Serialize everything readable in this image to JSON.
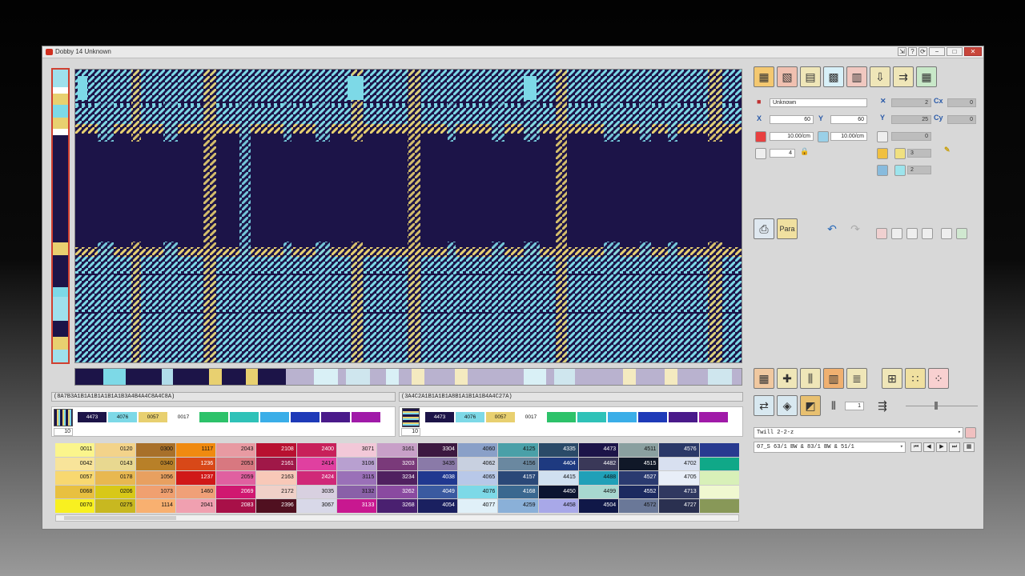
{
  "window": {
    "title": "Dobby 14 Unknown",
    "controls": [
      "⇲",
      "?",
      "⟳",
      "−",
      "□",
      "✕"
    ]
  },
  "colors": {
    "navy": "#1c1448",
    "cyan": "#7dd9e7",
    "yellow": "#e8d070",
    "lavender": "#b9b2cf"
  },
  "codes": {
    "warp": "(8A7B3A1B1A1B1A1B1A1B3A4B4A4C8A4C8A)",
    "weft": "(3A4C2A1B1A1B1A8B1A1B1A1B4A4C27A)"
  },
  "swatch_panels": [
    {
      "count": "10",
      "chips": [
        {
          "label": "4473",
          "color": "#1c1448"
        },
        {
          "label": "4076",
          "color": "#7dd9e7"
        },
        {
          "label": "0057",
          "color": "#e8d070"
        },
        {
          "label": "0017",
          "color": "#ffffff"
        },
        {
          "label": "",
          "color": "#2dc26a"
        },
        {
          "label": "",
          "color": "#2fc2b8"
        },
        {
          "label": "",
          "color": "#3aaee8"
        },
        {
          "label": "",
          "color": "#1e3ab8"
        },
        {
          "label": "",
          "color": "#4a1a8a"
        },
        {
          "label": "",
          "color": "#a01aa8"
        }
      ]
    },
    {
      "count": "10",
      "chips": [
        {
          "label": "4473",
          "color": "#1c1448"
        },
        {
          "label": "4076",
          "color": "#7dd9e7"
        },
        {
          "label": "0057",
          "color": "#e8d070"
        },
        {
          "label": "0017",
          "color": "#ffffff"
        },
        {
          "label": "",
          "color": "#2dc26a"
        },
        {
          "label": "",
          "color": "#2fc2b8"
        },
        {
          "label": "",
          "color": "#3aaee8"
        },
        {
          "label": "",
          "color": "#1e3ab8"
        },
        {
          "label": "",
          "color": "#4a1a8a"
        },
        {
          "label": "",
          "color": "#a01aa8"
        }
      ]
    }
  ],
  "palette": [
    {
      "code": "0011",
      "color": "#fbf58c"
    },
    {
      "code": "0120",
      "color": "#f3d38a"
    },
    {
      "code": "0300",
      "color": "#a8702a"
    },
    {
      "code": "1117",
      "color": "#f08a10"
    },
    {
      "code": "2043",
      "color": "#e89aa2"
    },
    {
      "code": "2108",
      "color": "#b81030"
    },
    {
      "code": "2400",
      "color": "#c8205a"
    },
    {
      "code": "3071",
      "color": "#f2c8d8"
    },
    {
      "code": "3161",
      "color": "#c8a0c8"
    },
    {
      "code": "3304",
      "color": "#3c1840"
    },
    {
      "code": "4060",
      "color": "#8aa0c8"
    },
    {
      "code": "4125",
      "color": "#4aa0a8"
    },
    {
      "code": "4335",
      "color": "#2a4a68"
    },
    {
      "code": "4473",
      "color": "#1c1448"
    },
    {
      "code": "4511",
      "color": "#8aa0a0"
    },
    {
      "code": "4576",
      "color": "#2a3868"
    },
    {
      "code": "",
      "color": "#283a90"
    },
    {
      "code": "0042",
      "color": "#f8e49a"
    },
    {
      "code": "0143",
      "color": "#e8d890"
    },
    {
      "code": "0340",
      "color": "#b88028"
    },
    {
      "code": "1236",
      "color": "#d84818"
    },
    {
      "code": "2053",
      "color": "#d87880"
    },
    {
      "code": "2161",
      "color": "#a01848"
    },
    {
      "code": "2414",
      "color": "#e040a0"
    },
    {
      "code": "3106",
      "color": "#b8a0d0"
    },
    {
      "code": "3203",
      "color": "#7a3a7a"
    },
    {
      "code": "3435",
      "color": "#8a7aa8"
    },
    {
      "code": "4062",
      "color": "#c8d0e0"
    },
    {
      "code": "4156",
      "color": "#6a88a0"
    },
    {
      "code": "4404",
      "color": "#1e3a80"
    },
    {
      "code": "4482",
      "color": "#3a3858"
    },
    {
      "code": "4515",
      "color": "#101828"
    },
    {
      "code": "4702",
      "color": "#d8e0f0"
    },
    {
      "code": "",
      "color": "#10a888"
    },
    {
      "code": "0057",
      "color": "#f8d870"
    },
    {
      "code": "0178",
      "color": "#e8b850"
    },
    {
      "code": "1056",
      "color": "#e8a060"
    },
    {
      "code": "1237",
      "color": "#d01818"
    },
    {
      "code": "2059",
      "color": "#e060a0"
    },
    {
      "code": "2163",
      "color": "#f8c8b8"
    },
    {
      "code": "2424",
      "color": "#d02878"
    },
    {
      "code": "3115",
      "color": "#9a70b8"
    },
    {
      "code": "3234",
      "color": "#502060"
    },
    {
      "code": "4038",
      "color": "#203890"
    },
    {
      "code": "4065",
      "color": "#b8c8e8"
    },
    {
      "code": "4157",
      "color": "#2a4878"
    },
    {
      "code": "4415",
      "color": "#d0e0f0"
    },
    {
      "code": "4488",
      "color": "#20a0b8"
    },
    {
      "code": "4527",
      "color": "#2a3a70"
    },
    {
      "code": "4705",
      "color": "#e8eef8"
    },
    {
      "code": "",
      "color": "#d8f0b8"
    },
    {
      "code": "0068",
      "color": "#e8c040"
    },
    {
      "code": "0206",
      "color": "#d8c818"
    },
    {
      "code": "1073",
      "color": "#f0a070"
    },
    {
      "code": "1460",
      "color": "#f0a078"
    },
    {
      "code": "2069",
      "color": "#d01870"
    },
    {
      "code": "2172",
      "color": "#f0d0c8"
    },
    {
      "code": "3035",
      "color": "#d8d0e0"
    },
    {
      "code": "3132",
      "color": "#8a60a8"
    },
    {
      "code": "3262",
      "color": "#8a4aa0"
    },
    {
      "code": "4049",
      "color": "#3a5aa0"
    },
    {
      "code": "4076",
      "color": "#7dd9e7"
    },
    {
      "code": "4168",
      "color": "#3a6890"
    },
    {
      "code": "4450",
      "color": "#0c1430"
    },
    {
      "code": "4499",
      "color": "#a8d8d0"
    },
    {
      "code": "4552",
      "color": "#1c2a60"
    },
    {
      "code": "4713",
      "color": "#303860"
    },
    {
      "code": "",
      "color": "#f0f8d0"
    },
    {
      "code": "0070",
      "color": "#f8f020"
    },
    {
      "code": "0275",
      "color": "#c8b820"
    },
    {
      "code": "1114",
      "color": "#f8b070"
    },
    {
      "code": "2041",
      "color": "#f0a0b0"
    },
    {
      "code": "2083",
      "color": "#a81048"
    },
    {
      "code": "2396",
      "color": "#501020"
    },
    {
      "code": "3067",
      "color": "#d8d8e8"
    },
    {
      "code": "3133",
      "color": "#c81890"
    },
    {
      "code": "3268",
      "color": "#4a2070"
    },
    {
      "code": "4054",
      "color": "#1a2060"
    },
    {
      "code": "4077",
      "color": "#e0f0f8"
    },
    {
      "code": "4259",
      "color": "#8ab0d8"
    },
    {
      "code": "4458",
      "color": "#a8a8e8"
    },
    {
      "code": "4504",
      "color": "#101848"
    },
    {
      "code": "4572",
      "color": "#6a7898"
    },
    {
      "code": "4727",
      "color": "#2a3050"
    },
    {
      "code": "",
      "color": "#889858"
    }
  ],
  "right_panel": {
    "name": "Unknown",
    "x_repeat": "2",
    "cx": "0",
    "width": "60",
    "height": "60",
    "y_repeat": "25",
    "cy": "0",
    "warp_density": "10.00/cm",
    "weft_density": "10.00/cm",
    "extra": "0",
    "lock_value": "4",
    "yarn_count_1": "3",
    "yarn_count_2": "2",
    "para_label": "Para",
    "slider_value": "1",
    "weave_name": "Twill 2-2-z",
    "weave_library": "07_S  63/1 BW & 83/1 BW & 51/1"
  }
}
